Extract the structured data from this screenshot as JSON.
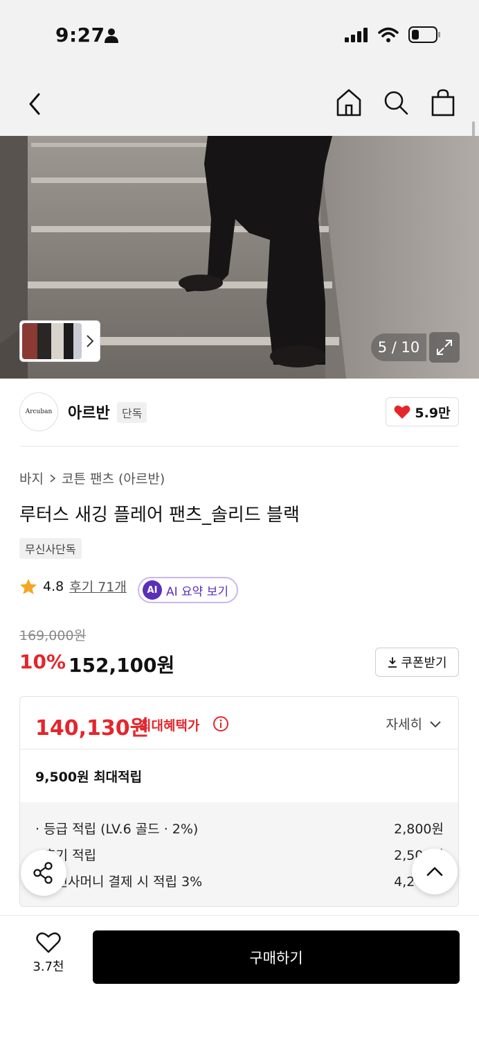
{
  "status_bar": {
    "time": "9:27"
  },
  "hero": {
    "counter": "5 / 10"
  },
  "brand": {
    "logo_text": "Arcuban",
    "name": "아르반",
    "tag": "단독",
    "likes": "5.9만"
  },
  "breadcrumb": {
    "category": "바지",
    "subcategory": "코튼 팬츠 (아르반)"
  },
  "product": {
    "title": "루터스 새깅 플레어 팬츠_솔리드 블랙",
    "exclusive_tag": "무신사단독",
    "rating": "4.8",
    "reviews": "후기 71개",
    "ai_badge": "AI",
    "ai_summary_label": "AI 요약 보기"
  },
  "pricing": {
    "original_price": "169,000원",
    "discount": "10%",
    "sale_price": "152,100원",
    "coupon_label": "쿠폰받기"
  },
  "benefits": {
    "max_price": "140,130원",
    "max_label": "최대혜택가",
    "detail_label": "자세히",
    "points_total": "9,500원 최대적립",
    "points": [
      {
        "label": "· 등급 적립 (LV.6 골드 · 2%)",
        "value": "2,800원"
      },
      {
        "label": "· 후기 적립",
        "value": "2,500원"
      },
      {
        "label": "· 무신사머니 결제 시 적립 3%",
        "value": "4,200원"
      }
    ]
  },
  "bottom_bar": {
    "wish_count": "3.7천",
    "buy_label": "구매하기"
  },
  "colors": {
    "accent_red": "#e4262c",
    "ai_purple": "#5b2fb8",
    "black": "#000000"
  }
}
